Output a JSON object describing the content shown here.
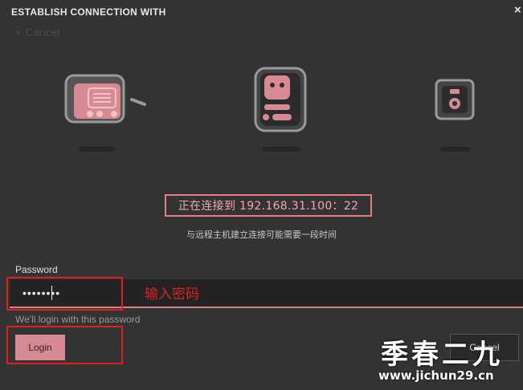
{
  "dialog": {
    "title": "ESTABLISH CONNECTION WITH",
    "close_glyph": "×",
    "ghost_cancel": "Cancel"
  },
  "status": {
    "connecting_text": "正在连接到 192.168.31.100：22",
    "note": "与远程主机建立连接可能需要一段时间"
  },
  "password": {
    "label": "Password",
    "value": "••••••••",
    "hint": "We'll login with this password"
  },
  "buttons": {
    "login": "Login",
    "cancel": "Cancel"
  },
  "annotation": {
    "text": "输入密码"
  },
  "watermark": {
    "title": "季春二九",
    "url": "www.jichun29.cn"
  },
  "colors": {
    "background": "#333333",
    "accent_pink": "#d88a93",
    "annotation_red": "#e02020"
  },
  "icons": [
    "radio-device-icon",
    "robot-device-icon",
    "server-device-icon"
  ]
}
